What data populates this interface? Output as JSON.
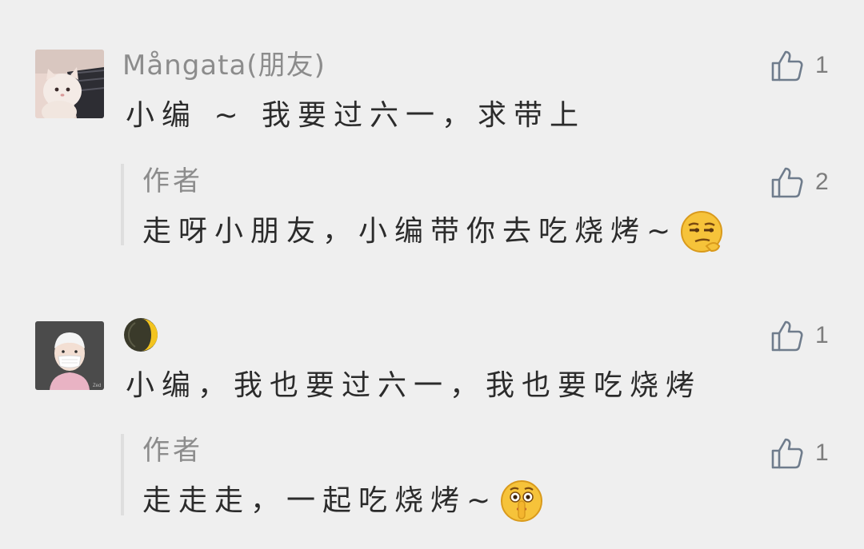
{
  "comments": [
    {
      "author": "Mångata(朋友)",
      "text": "小编 ~ 我要过六一，求带上",
      "likes": "1",
      "reply": {
        "author": "作者",
        "text": "走呀小朋友，小编带你去吃烧烤~",
        "likes": "2",
        "emoji": "smirk-emoji"
      }
    },
    {
      "author": "",
      "author_icon": "crescent-moon-icon",
      "text": "小编，我也要过六一，我也要吃烧烤",
      "likes": "1",
      "reply": {
        "author": "作者",
        "text": "走走走，一起吃烧烤~",
        "likes": "1",
        "emoji": "shush-emoji"
      }
    }
  ],
  "icons": {
    "like": "thumbs-up-icon"
  },
  "colors": {
    "background": "#efefef",
    "name": "#8c8c8c",
    "text": "#2b2b2b",
    "reply_bar": "#dedede",
    "like_icon": "#6f7c8c"
  }
}
